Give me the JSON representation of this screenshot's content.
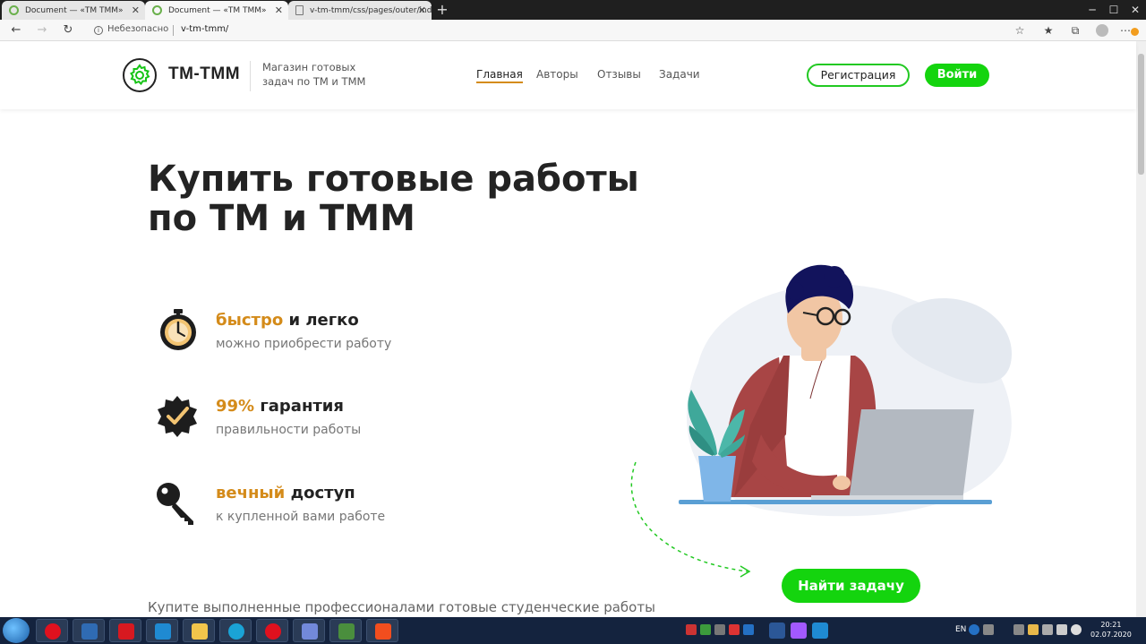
{
  "browser": {
    "tabs": [
      {
        "title": "Document — «ТМ ТММ»"
      },
      {
        "title": "Document — «ТМ ТММ»"
      },
      {
        "title": "v-tm-tmm/css/pages/outer/inde"
      }
    ],
    "security_label": "Небезопасно",
    "url": "v-tm-tmm/"
  },
  "header": {
    "logo_text": "ТМ-ТММ",
    "tagline": "Магазин готовых задач по ТМ и ТММ",
    "nav": [
      {
        "label": "Главная",
        "active": true
      },
      {
        "label": "Авторы",
        "active": false
      },
      {
        "label": "Отзывы",
        "active": false
      },
      {
        "label": "Задачи",
        "active": false
      }
    ],
    "register_label": "Регистрация",
    "login_label": "Войти"
  },
  "hero": {
    "title": "Купить готовые работы по ТМ и ТММ",
    "features": [
      {
        "accent": "быстро",
        "rest": " и легко",
        "sub": "можно приобрести работу",
        "icon": "stopwatch-icon"
      },
      {
        "accent": "99%",
        "rest": " гарантия",
        "sub": "правильности работы",
        "icon": "verified-badge-icon"
      },
      {
        "accent": "вечный",
        "rest": " доступ",
        "sub": "к купленной вами работе",
        "icon": "key-icon"
      }
    ],
    "find_button_label": "Найти задачу",
    "bottom_text": "Купите выполненные профессионалами готовые студенческие работы"
  },
  "taskbar": {
    "language": "EN",
    "time": "20:21",
    "date": "02.07.2020"
  },
  "colors": {
    "accent_green": "#14d40e",
    "accent_orange": "#d48b1a",
    "text_dark": "#232323"
  }
}
